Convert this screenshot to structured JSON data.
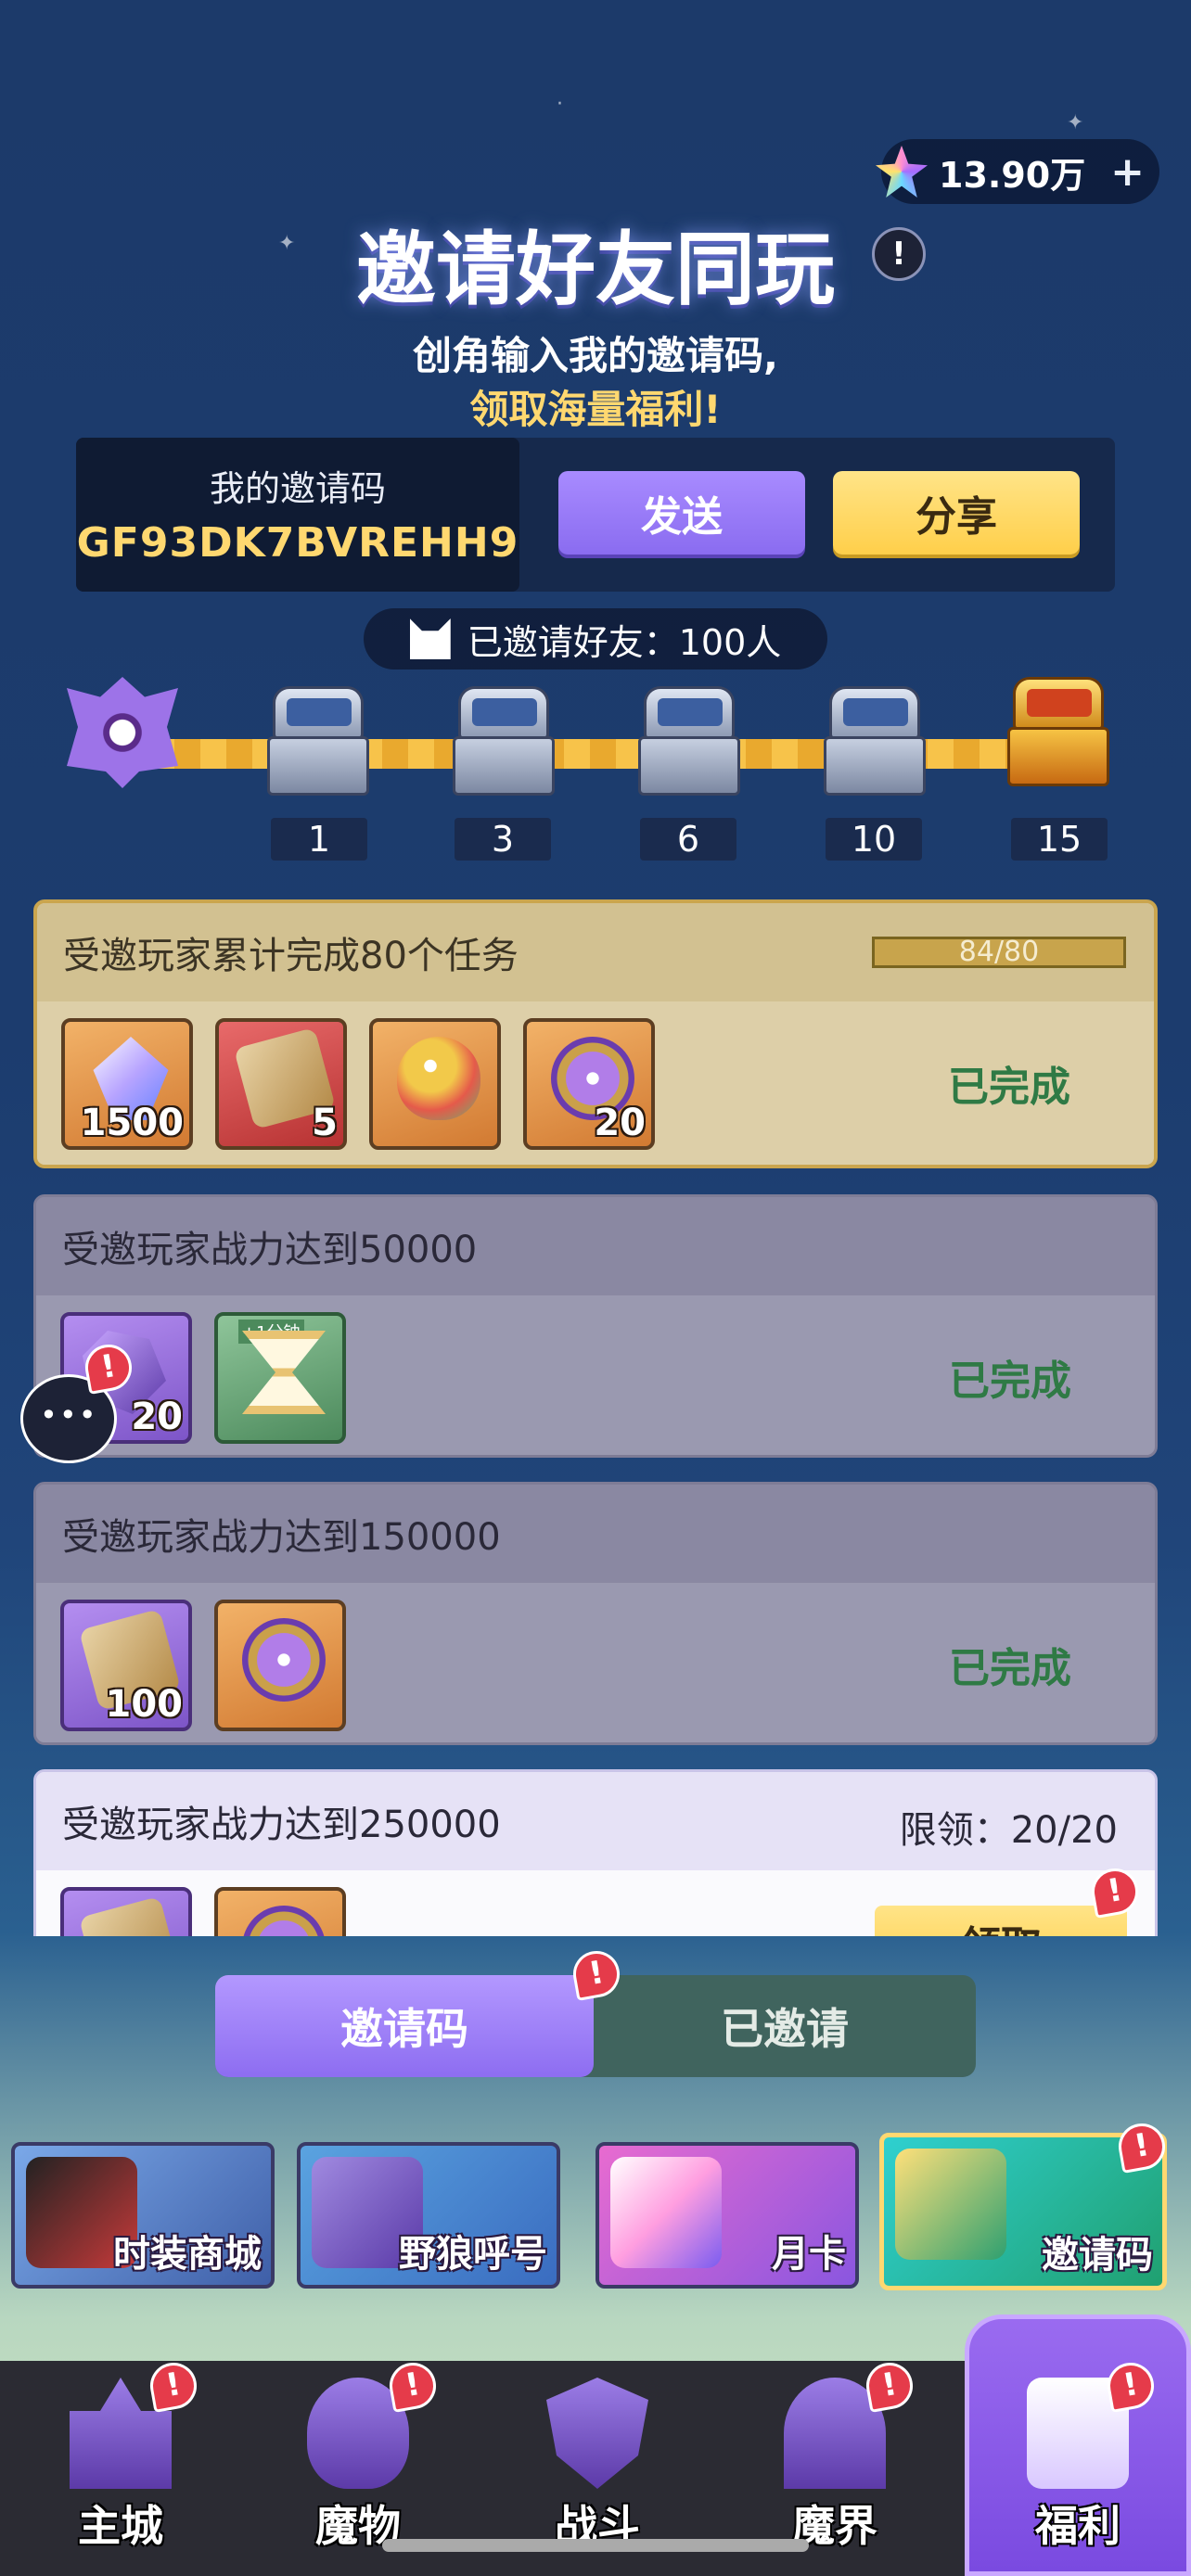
{
  "currency": {
    "value": "13.90万",
    "plus": "+"
  },
  "header": {
    "title": "邀请好友同玩",
    "info": "!",
    "subtitle_line1": "创角输入我的邀请码,",
    "subtitle_line2": "领取海量福利!"
  },
  "invite_code": {
    "label": "我的邀请码",
    "code": "GF93DK7BVREHH9",
    "send_label": "发送",
    "share_label": "分享"
  },
  "invited": {
    "text": "已邀请好友：100人"
  },
  "milestones": [
    "1",
    "3",
    "6",
    "10",
    "15"
  ],
  "tasks": [
    {
      "title": "受邀玩家累计完成80个任务",
      "progress": "84/80",
      "progress_fraction": 1.0,
      "status": "已完成",
      "rewards": [
        {
          "icon": "crystal-icon",
          "qty": "1500"
        },
        {
          "icon": "scroll-icon",
          "qty": "5"
        },
        {
          "icon": "egg-icon",
          "qty": ""
        },
        {
          "icon": "medal-icon",
          "qty": "20"
        }
      ]
    },
    {
      "title": "受邀玩家战力达到50000",
      "status": "已完成",
      "rewards": [
        {
          "icon": "gem-icon",
          "qty": "20"
        },
        {
          "icon": "hourglass-icon",
          "qty": "",
          "tag": "+1分钟"
        }
      ]
    },
    {
      "title": "受邀玩家战力达到150000",
      "status": "已完成",
      "rewards": [
        {
          "icon": "scroll-icon",
          "qty": "100"
        },
        {
          "icon": "medal-icon",
          "qty": ""
        }
      ]
    },
    {
      "title": "受邀玩家战力达到250000",
      "limit": "限领：20/20",
      "claim": "领取",
      "rewards": [
        {
          "icon": "scroll-icon",
          "qty": ""
        },
        {
          "icon": "medal-icon",
          "qty": ""
        }
      ]
    }
  ],
  "tabs": {
    "invite_code": "邀请码",
    "invited": "已邀请"
  },
  "banners": [
    "时装商城",
    "野狼呼号",
    "月卡",
    "邀请码"
  ],
  "nav": [
    "主城",
    "魔物",
    "战斗",
    "魔界",
    "福利"
  ],
  "colors": {
    "accent_purple": "#8d6df1",
    "accent_gold": "#ffd870",
    "done_green": "#2f7a45",
    "badge_red": "#e53b4a"
  }
}
